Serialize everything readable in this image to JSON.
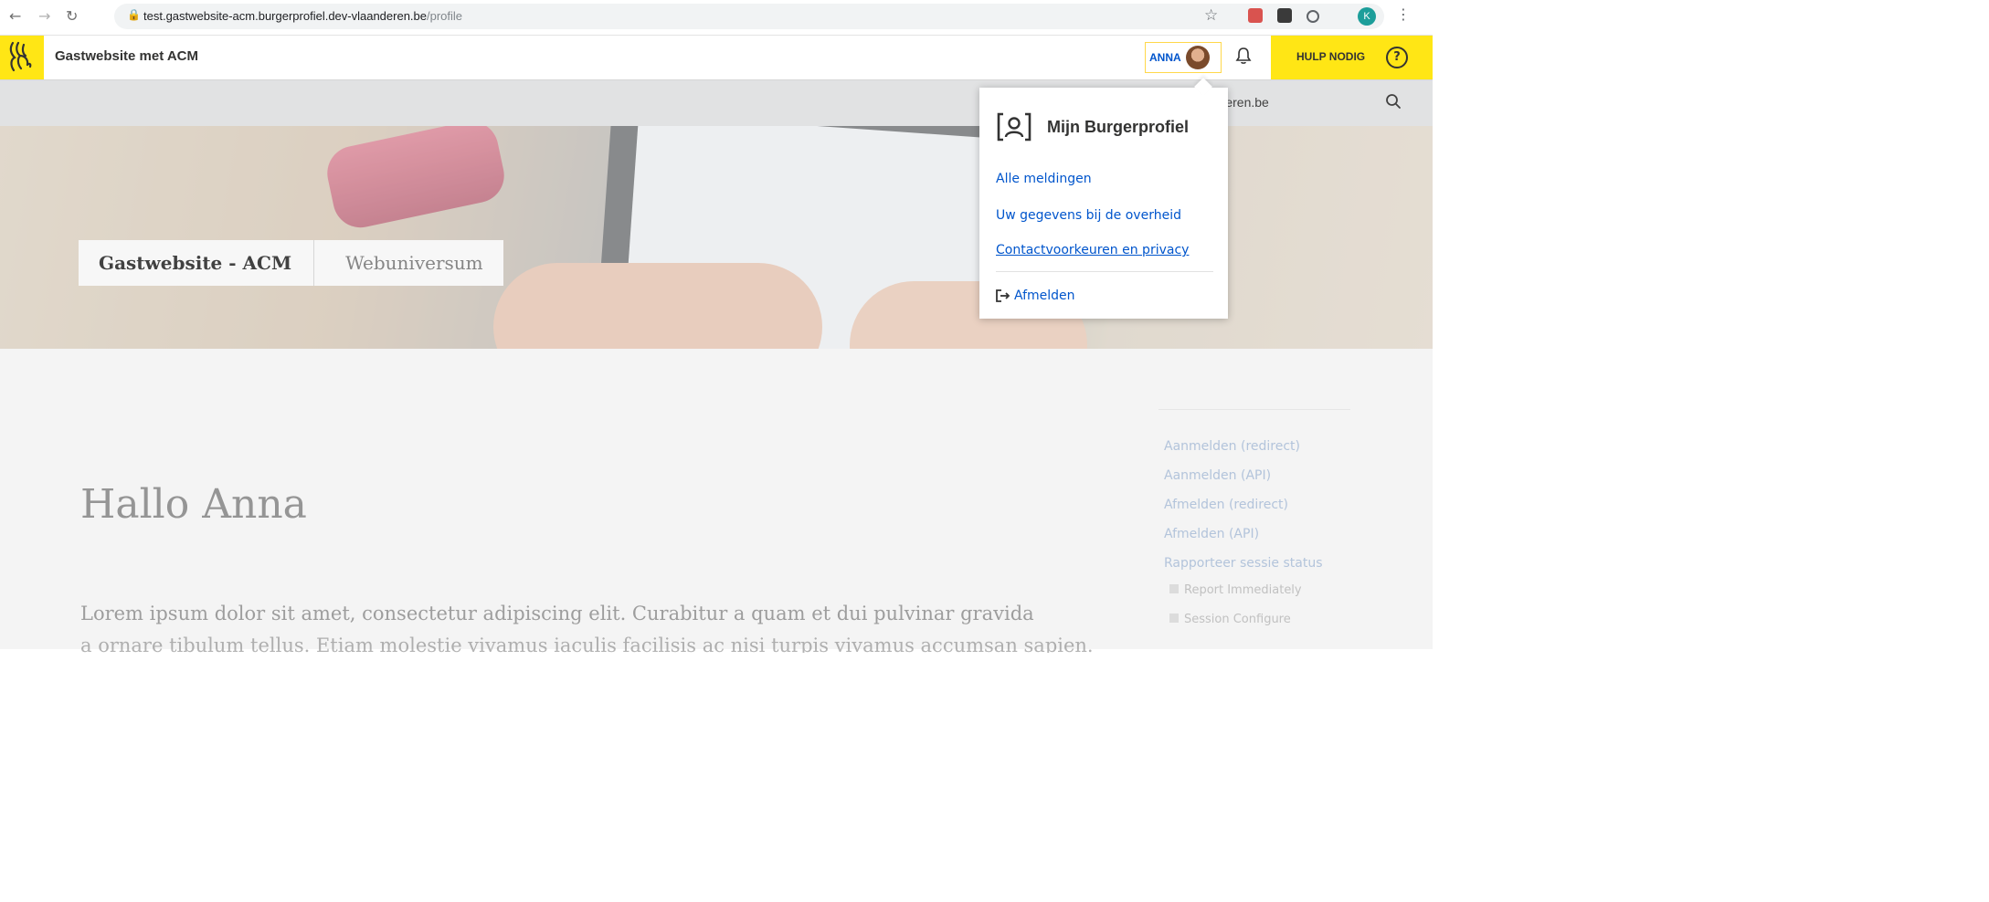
{
  "browser": {
    "url_host": "test.gastwebsite-acm.burgerprofiel.dev-vlaanderen.be",
    "url_path": "/profile",
    "profile_initial": "K",
    "ext_colors": [
      "#d9534f",
      "#3a3a3a",
      "#5f6368"
    ]
  },
  "header": {
    "site_title": "Gastwebsite met ACM",
    "user_name": "ANNA",
    "help_label": "HULP NODIG",
    "help_icon": "?",
    "accent": "#ffe615",
    "link_color": "#0055cc"
  },
  "subbar": {
    "visible_text": "anderen.be"
  },
  "hero": {
    "breadcrumbs": [
      "Gastwebsite - ACM",
      "Webuniversum"
    ]
  },
  "main": {
    "greeting": "Hallo Anna",
    "lorem_line1": "Lorem ipsum dolor sit amet, consectetur adipiscing elit. Curabitur a quam et dui pulvinar gravida",
    "lorem_line2": "a ornare tibulum tellus. Etiam molestie vivamus iaculis facilisis ac nisi turpis vivamus accumsan sapien."
  },
  "sidebar": {
    "links": [
      "Aanmelden (redirect)",
      "Aanmelden (API)",
      "Afmelden (redirect)",
      "Afmelden (API)",
      "Rapporteer sessie status"
    ],
    "checkboxes": [
      "Report Immediately",
      "Session Configure"
    ]
  },
  "dropdown": {
    "title": "Mijn Burgerprofiel",
    "links": [
      "Alle meldingen",
      "Uw gegevens bij de overheid",
      "Contactvoorkeuren en privacy"
    ],
    "logout": "Afmelden"
  }
}
